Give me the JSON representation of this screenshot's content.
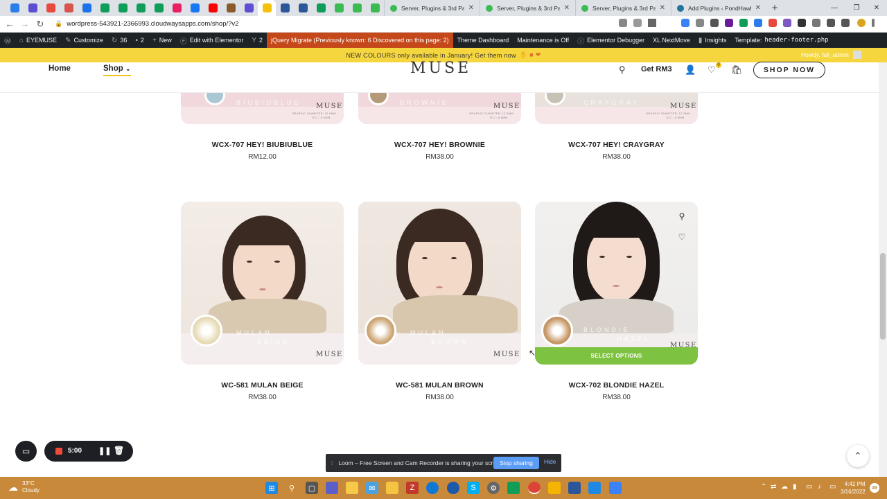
{
  "browser": {
    "mini_tabs": [
      {
        "color": "#2b7de9"
      },
      {
        "color": "#5d4fd1"
      },
      {
        "color": "#e84b3c"
      },
      {
        "color": "#d9534f"
      },
      {
        "color": "#1a73e8"
      },
      {
        "color": "#0f9d58"
      },
      {
        "color": "#0f9d58"
      },
      {
        "color": "#0f9d58"
      },
      {
        "color": "#0f9d58"
      },
      {
        "color": "#e91e63"
      },
      {
        "color": "#1877f2"
      },
      {
        "color": "#ff0000"
      },
      {
        "color": "#8b5a2b"
      },
      {
        "color": "#5d4fd1"
      },
      {
        "color": "#f4c20d"
      },
      {
        "color": "#2b579a"
      },
      {
        "color": "#2b579a"
      },
      {
        "color": "#0f9d58"
      },
      {
        "color": "#3cba54"
      },
      {
        "color": "#3cba54"
      },
      {
        "color": "#3cba54"
      }
    ],
    "full_tabs": [
      {
        "title": "Server, Plugins & 3rd Party",
        "color": "#3cba54"
      },
      {
        "title": "Server, Plugins & 3rd Party",
        "color": "#3cba54"
      },
      {
        "title": "Server, Plugins & 3rd Party",
        "color": "#3cba54"
      },
      {
        "title": "Add Plugins ‹ PondHawk —",
        "color": "#21759b"
      }
    ],
    "url": "wordpress-543921-2366993.cloudwaysapps.com/shop/?v2",
    "new_tab": "+",
    "win_minimize": "—",
    "win_restore": "❐",
    "win_close": "✕"
  },
  "wp_admin": {
    "site_name": "EYEMUSE",
    "customize": "Customize",
    "updates_count": "36",
    "comments_count": "2",
    "new_label": "New",
    "elementor": "Edit with Elementor",
    "yoast_count": "2",
    "migrate": "jQuery Migrate (Previously known: 6 Discovered on this page: 2)",
    "theme_dashboard": "Theme Dashboard",
    "maintenance": "Maintenance is Off",
    "debugger": "Elementor Debugger",
    "nextmove": "XL NextMove",
    "insights": "Insights",
    "template_label": "Template:",
    "template_file": "header-footer.php",
    "howdy": "Howdy, full_admin"
  },
  "announcement": "NEW COLOURS only available in January! Get them now",
  "header": {
    "home": "Home",
    "shop": "Shop",
    "logo": "MUSE",
    "get_rm3": "Get RM3",
    "wishlist_count": "0",
    "shop_now": "SHOP NOW"
  },
  "products_top": [
    {
      "title": "WCX-707 HEY! BIUBIUBLUE",
      "price": "RM12.00",
      "variant": "BIUBIUBLUE",
      "lens_color": "#a9c8d4"
    },
    {
      "title": "WCX-707 HEY! BROWNIE",
      "price": "RM38.00",
      "variant": "BROWNIE",
      "lens_color": "#b59a7a"
    },
    {
      "title": "WCX-707 HEY! CRAYGRAY",
      "price": "RM38.00",
      "variant": "CRAYGRAY",
      "lens_color": "#c7c2b3"
    }
  ],
  "products_bottom": [
    {
      "title": "WC-581 MULAN BEIGE",
      "price": "RM38.00",
      "variant_line1": "MULAN",
      "variant_line2": "BEIGE",
      "lens_color": "#e8dcb9"
    },
    {
      "title": "WC-581 MULAN BROWN",
      "price": "RM38.00",
      "variant_line1": "MULAN",
      "variant_line2": "BROWN",
      "lens_color": "#cfa97a"
    },
    {
      "title": "WCX-702 BLONDIE HAZEL",
      "price": "RM38.00",
      "variant_line1": "BLONDIE",
      "variant_line2": "HAZEL",
      "lens_color": "#c99a6a"
    }
  ],
  "card_brand": "MUSE",
  "card_spec_1": "GRAPHIC DIAMETER: 12.5MM",
  "card_spec_2": "B.C.: 8.6MM",
  "select_options": "SELECT OPTIONS",
  "loom": {
    "timer": "5:00",
    "share_message": "Loom – Free Screen and Cam Recorder is sharing your screen.",
    "stop_sharing": "Stop sharing",
    "hide": "Hide"
  },
  "taskbar": {
    "temp": "33°C",
    "weather": "Cloudy",
    "time": "4:42 PM",
    "date": "3/16/2022",
    "notifications": "49"
  }
}
